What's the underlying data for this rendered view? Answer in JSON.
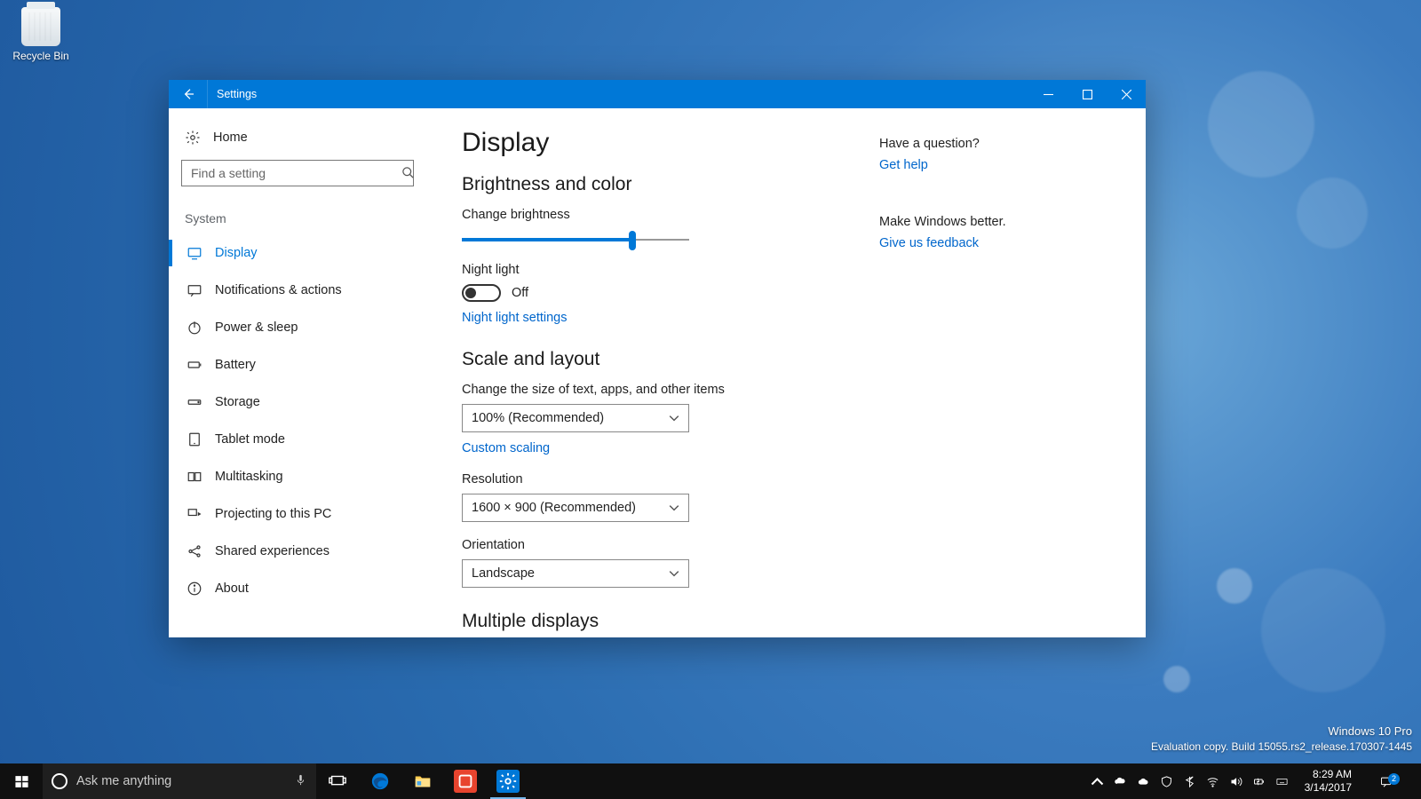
{
  "desktop": {
    "recycle_bin": "Recycle Bin",
    "watermark_line1": "Windows 10 Pro",
    "watermark_line2": "Evaluation copy. Build 15055.rs2_release.170307-1445"
  },
  "window": {
    "title": "Settings",
    "home": "Home",
    "search_placeholder": "Find a setting",
    "category": "System",
    "nav": [
      {
        "label": "Display",
        "active": true
      },
      {
        "label": "Notifications & actions",
        "active": false
      },
      {
        "label": "Power & sleep",
        "active": false
      },
      {
        "label": "Battery",
        "active": false
      },
      {
        "label": "Storage",
        "active": false
      },
      {
        "label": "Tablet mode",
        "active": false
      },
      {
        "label": "Multitasking",
        "active": false
      },
      {
        "label": "Projecting to this PC",
        "active": false
      },
      {
        "label": "Shared experiences",
        "active": false
      },
      {
        "label": "About",
        "active": false
      }
    ]
  },
  "page": {
    "title": "Display",
    "section_brightness": "Brightness and color",
    "brightness_label": "Change brightness",
    "brightness_percent": 75,
    "night_light_label": "Night light",
    "night_light_state": "Off",
    "night_light_settings": "Night light settings",
    "section_scale": "Scale and layout",
    "scale_label": "Change the size of text, apps, and other items",
    "scale_value": "100% (Recommended)",
    "custom_scaling": "Custom scaling",
    "resolution_label": "Resolution",
    "resolution_value": "1600 × 900 (Recommended)",
    "orientation_label": "Orientation",
    "orientation_value": "Landscape",
    "section_multiple": "Multiple displays"
  },
  "rail": {
    "question": "Have a question?",
    "get_help": "Get help",
    "make_better": "Make Windows better.",
    "feedback": "Give us feedback"
  },
  "taskbar": {
    "cortana": "Ask me anything",
    "time": "8:29 AM",
    "date": "3/14/2017",
    "notification_count": "2"
  }
}
